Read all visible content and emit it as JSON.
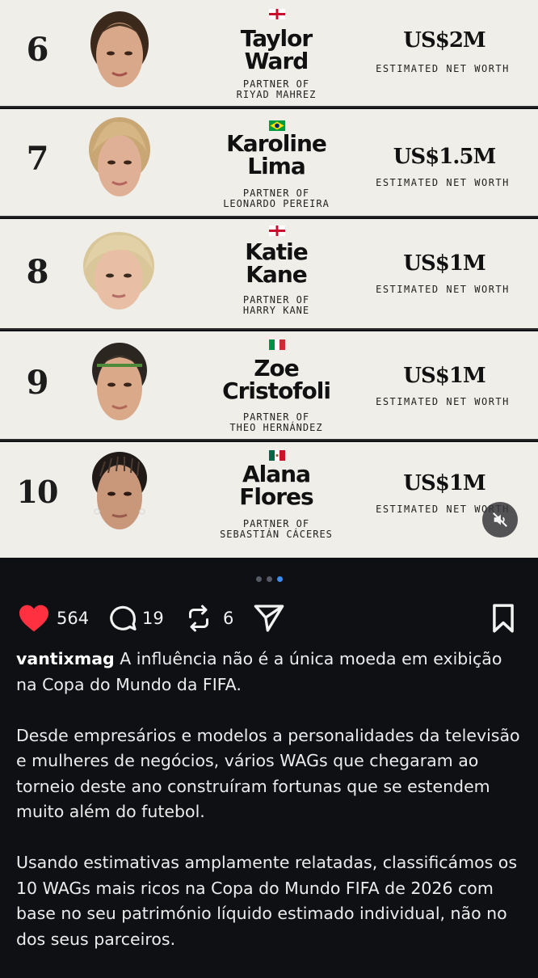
{
  "rankings": [
    {
      "rank": "6",
      "first_name": "Taylor",
      "last_name": "Ward",
      "flag": "england-flag",
      "partner_prefix": "PARTNER OF",
      "partner": "RIYAD MAHREZ",
      "net_worth": "US$2M",
      "net_worth_label": "ESTIMATED NET WORTH"
    },
    {
      "rank": "7",
      "first_name": "Karoline",
      "last_name": "Lima",
      "flag": "brazil-flag",
      "partner_prefix": "PARTNER OF",
      "partner": "LEONARDO PEREIRA",
      "net_worth": "US$1.5M",
      "net_worth_label": "ESTIMATED NET WORTH"
    },
    {
      "rank": "8",
      "first_name": "Katie",
      "last_name": "Kane",
      "flag": "england-flag",
      "partner_prefix": "PARTNER OF",
      "partner": "HARRY KANE",
      "net_worth": "US$1M",
      "net_worth_label": "ESTIMATED NET WORTH"
    },
    {
      "rank": "9",
      "first_name": "Zoe",
      "last_name": "Cristofoli",
      "flag": "italy-flag",
      "partner_prefix": "PARTNER OF",
      "partner": "THEO HERNÁNDEZ",
      "net_worth": "US$1M",
      "net_worth_label": "ESTIMATED NET WORTH"
    },
    {
      "rank": "10",
      "first_name": "Alana",
      "last_name": "Flores",
      "flag": "mexico-flag",
      "partner_prefix": "PARTNER OF",
      "partner": "SEBASTIÁN CÁCERES",
      "net_worth": "US$1M",
      "net_worth_label": "ESTIMATED NET WORTH"
    }
  ],
  "carousel": {
    "slide_count": 3,
    "active_slide": 3
  },
  "actions": {
    "likes": "564",
    "comments": "19",
    "reposts": "6",
    "like_icon": "heart-icon",
    "comment_icon": "comment-icon",
    "repost_icon": "repost-icon",
    "share_icon": "send-icon",
    "save_icon": "bookmark-icon",
    "mute_icon": "muted-speaker-icon"
  },
  "caption": {
    "username": "vantixmag",
    "text1": "A influência não é a única moeda em exibição na Copa do Mundo da FIFA.",
    "paragraph2": "Desde empresários e modelos a personalidades da televisão e mulheres de negócios, vários WAGs que chegaram ao torneio deste ano construíram fortunas que se estendem muito além do futebol.",
    "paragraph3": "Usando estimativas amplamente relatadas, classificámos os 10 WAGs mais ricos na Copa do Mundo FIFA de 2026 com base no seu património líquido estimado individual, não no dos seus parceiros."
  },
  "colors": {
    "card_bg": "#efeee8",
    "app_bg": "#0f1014",
    "like_red": "#ff3040",
    "dot_active": "#3d8cf0"
  }
}
